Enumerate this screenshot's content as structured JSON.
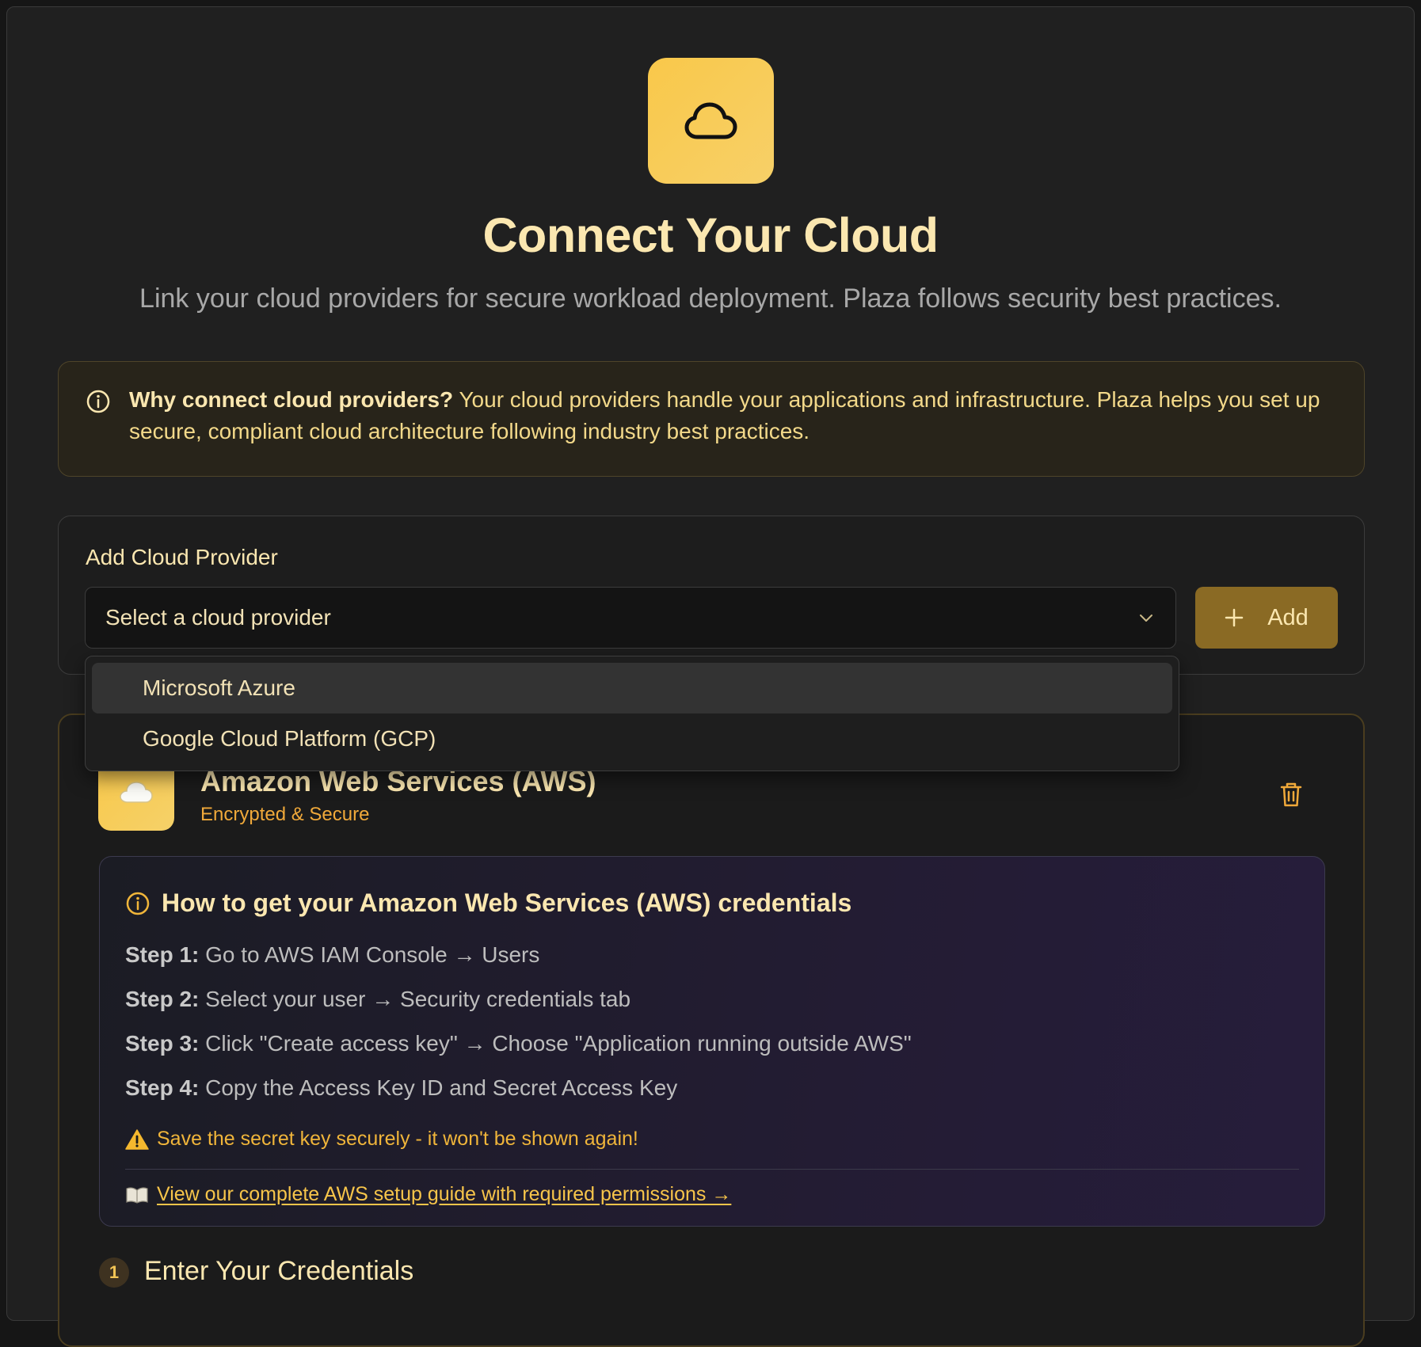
{
  "header": {
    "title": "Connect Your Cloud",
    "subtitle": "Link your cloud providers for secure workload deployment. Plaza follows security best practices."
  },
  "info_box": {
    "heading": "Why connect cloud providers?",
    "body": " Your cloud providers handle your applications and infrastructure. Plaza helps you set up secure, compliant cloud architecture following industry best practices."
  },
  "add_provider": {
    "label": "Add Cloud Provider",
    "select_placeholder": "Select a cloud provider",
    "add_button_label": "Add",
    "options": [
      {
        "label": "Microsoft Azure",
        "highlighted": true
      },
      {
        "label": "Google Cloud Platform (GCP)",
        "highlighted": false
      }
    ]
  },
  "provider_card": {
    "name": "Amazon Web Services (AWS)",
    "status": "Encrypted & Secure",
    "howto": {
      "title": "How to get your Amazon Web Services (AWS) credentials",
      "steps": [
        {
          "label": "Step 1:",
          "text": " Go to AWS IAM Console → Users"
        },
        {
          "label": "Step 2:",
          "text": " Select your user → Security credentials tab"
        },
        {
          "label": "Step 3:",
          "text": " Click \"Create access key\" → Choose \"Application running outside AWS\""
        },
        {
          "label": "Step 4:",
          "text": " Copy the Access Key ID and Secret Access Key"
        }
      ],
      "warning": "Save the secret key securely - it won't be shown again!",
      "guide_link": "View our complete AWS setup guide with required permissions →"
    },
    "section": {
      "number": "1",
      "title": "Enter Your Credentials"
    }
  },
  "colors": {
    "accent": "#f9c84a",
    "title": "#fbe7b0",
    "status": "#f0a93a",
    "background": "#202020"
  }
}
